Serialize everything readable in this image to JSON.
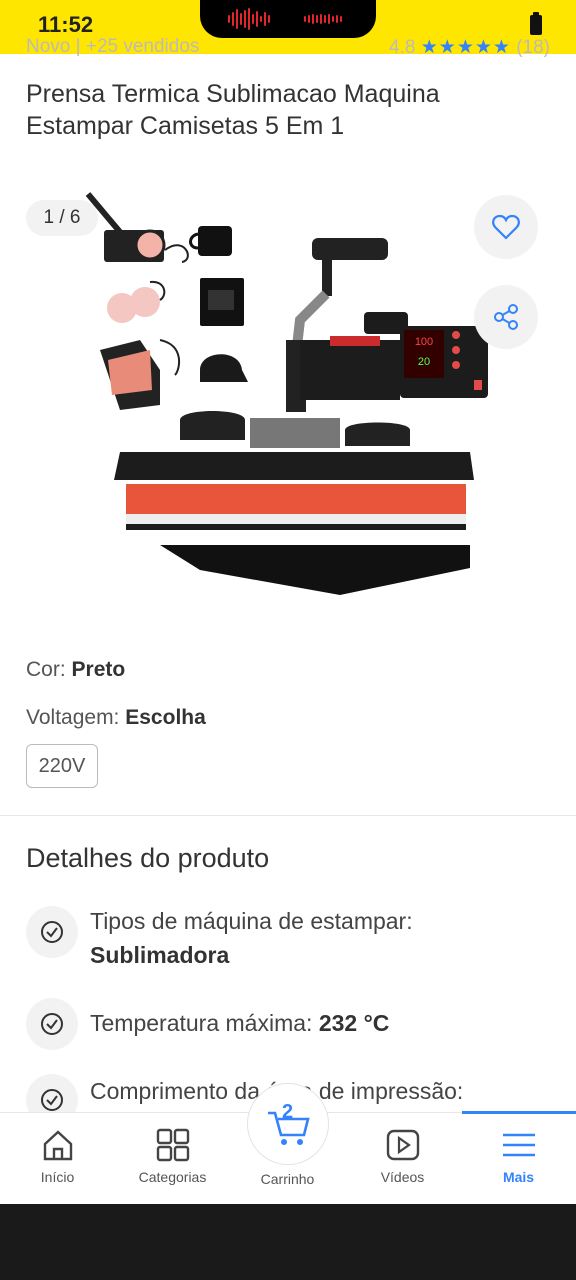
{
  "status": {
    "time": "11:52"
  },
  "header_cut": {
    "left": "Novo | +25 vendidos",
    "rating": "4.8",
    "stars": "★★★★★",
    "reviews": "(18)"
  },
  "product": {
    "title": "Prensa Termica Sublimacao Maquina Estampar Camisetas 5 Em 1"
  },
  "gallery": {
    "counter": "1 / 6"
  },
  "attributes": {
    "color_label": "Cor:",
    "color_value": "Preto",
    "voltage_label": "Voltagem:",
    "voltage_value": "Escolha",
    "voltage_option": "220V"
  },
  "details": {
    "title": "Detalhes do produto",
    "items": [
      {
        "label": "Tipos de máquina de estampar:",
        "value": "Sublimadora"
      },
      {
        "label": "Temperatura máxima:",
        "value": "232 °C"
      },
      {
        "label": "Comprimento da área de impressão:",
        "value": ""
      }
    ]
  },
  "nav": {
    "items": [
      {
        "label": "Início",
        "icon": "home-icon"
      },
      {
        "label": "Categorias",
        "icon": "grid-icon"
      },
      {
        "label": "Carrinho",
        "icon": "cart-icon",
        "count": "2"
      },
      {
        "label": "Vídeos",
        "icon": "play-icon"
      },
      {
        "label": "Mais",
        "icon": "menu-icon",
        "active": true
      }
    ]
  },
  "colors": {
    "brand_yellow": "#FFE600",
    "accent_blue": "#3483fa",
    "press_red": "#e8553a"
  }
}
